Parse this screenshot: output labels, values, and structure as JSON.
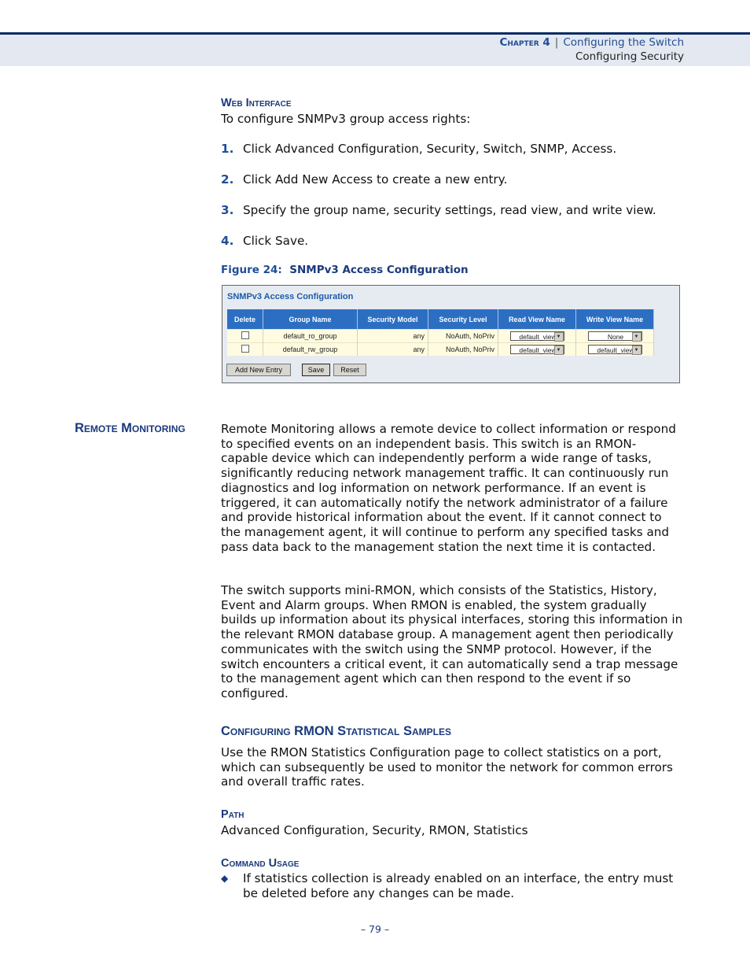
{
  "header": {
    "chapter": "Chapter 4",
    "separator": "|",
    "chapter_title": "Configuring the Switch",
    "section_title": "Configuring Security"
  },
  "web_interface": {
    "heading": "Web Interface",
    "intro": "To configure SNMPv3 group access rights:",
    "steps": [
      {
        "num": "1.",
        "text": "Click Advanced Configuration, Security, Switch, SNMP, Access."
      },
      {
        "num": "2.",
        "text": "Click Add New Access to create a new entry."
      },
      {
        "num": "3.",
        "text": "Specify the group name, security settings, read view, and write view."
      },
      {
        "num": "4.",
        "text": "Click Save."
      }
    ]
  },
  "figure": {
    "label": "Figure 24:",
    "caption": "SNMPv3 Access Configuration",
    "panel_title": "SNMPv3 Access Configuration",
    "columns": [
      "Delete",
      "Group Name",
      "Security Model",
      "Security Level",
      "Read View Name",
      "Write View Name"
    ],
    "rows": [
      {
        "group": "default_ro_group",
        "model": "any",
        "level": "NoAuth, NoPriv",
        "read_view": "default_view",
        "write_view": "None"
      },
      {
        "group": "default_rw_group",
        "model": "any",
        "level": "NoAuth, NoPriv",
        "read_view": "default_view",
        "write_view": "default_view"
      }
    ],
    "buttons": {
      "add": "Add New Entry",
      "save": "Save",
      "reset": "Reset"
    }
  },
  "remote_monitoring": {
    "heading": "Remote Monitoring",
    "para1": "Remote Monitoring allows a remote device to collect information or respond to specified events on an independent basis. This switch is an RMON-capable device which can independently perform a wide range of tasks, significantly reducing network management traffic. It can continuously run diagnostics and log information on network performance. If an event is triggered, it can automatically notify the network administrator of a failure and provide historical information about the event. If it cannot connect to the management agent, it will continue to perform any specified tasks and pass data back to the management station the next time it is contacted.",
    "para2": "The switch supports mini-RMON, which consists of the Statistics, History, Event and Alarm groups. When RMON is enabled, the system gradually builds up information about its physical interfaces, storing this information in the relevant RMON database group. A management agent then periodically communicates with the switch using the SNMP protocol. However, if the switch encounters a critical event, it can automatically send a trap message to the management agent which can then respond to the event if so configured."
  },
  "rmon_stats": {
    "heading": "Configuring RMON Statistical Samples",
    "intro": "Use the RMON Statistics Configuration page to collect statistics on a port, which can subsequently be used to monitor the network for common errors and overall traffic rates.",
    "path_heading": "Path",
    "path": "Advanced Configuration, Security, RMON, Statistics",
    "usage_heading": "Command Usage",
    "usage_items": [
      "If statistics collection is already enabled on an interface, the entry must be deleted before any changes can be made."
    ]
  },
  "footer": {
    "page_number": "–  79  –"
  }
}
